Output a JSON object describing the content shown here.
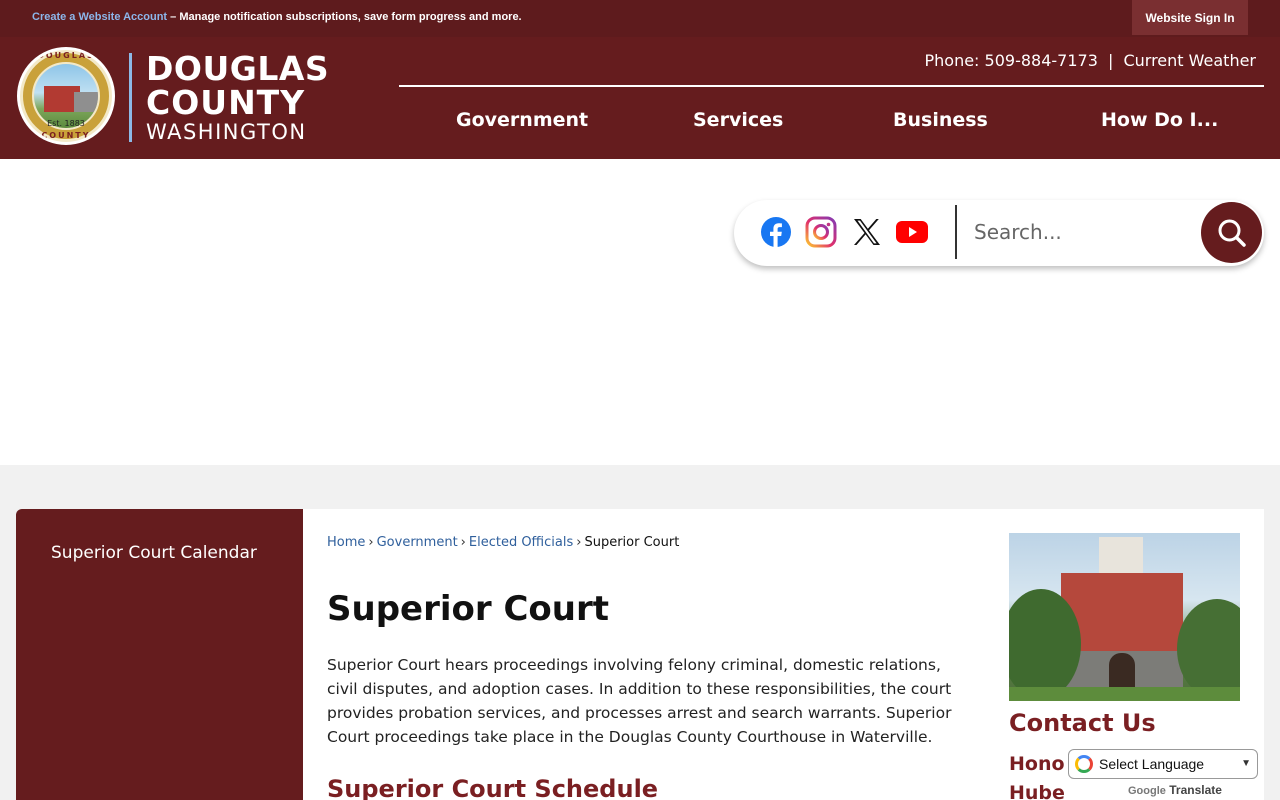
{
  "topbar": {
    "account_link": "Create a Website Account",
    "account_desc": " – Manage notification subscriptions, save form progress and more.",
    "signin_label": "Website Sign In"
  },
  "header": {
    "logo": {
      "seal_top": "DOUGLAS",
      "seal_est": "Est. 1883",
      "seal_bottom": "COUNTY",
      "line1": "DOUGLAS",
      "line2": "COUNTY",
      "line3": "WASHINGTON"
    },
    "phone": "Phone: 509-884-7173",
    "separator": "|",
    "weather": "Current Weather",
    "nav": [
      {
        "label": "Government"
      },
      {
        "label": "Services"
      },
      {
        "label": "Business"
      },
      {
        "label": "How Do I..."
      }
    ]
  },
  "social": {
    "icons": [
      "facebook-icon",
      "instagram-icon",
      "x-icon",
      "youtube-icon"
    ]
  },
  "search": {
    "placeholder": "Search..."
  },
  "sidebar": {
    "items": [
      {
        "label": "Superior Court Calendar"
      }
    ]
  },
  "breadcrumb": {
    "items": [
      {
        "label": "Home"
      },
      {
        "label": "Government"
      },
      {
        "label": "Elected Officials"
      },
      {
        "label": "Superior Court"
      }
    ],
    "separator": "›"
  },
  "main": {
    "title": "Superior Court",
    "body": "Superior Court hears proceedings involving felony criminal, domestic relations, civil disputes, and adoption cases. In addition to these responsibilities, the court provides probation services, and processes arrest and search warrants. Superior Court proceedings take place in the Douglas County Courthouse in Waterville.",
    "section_heading": "Superior Court Schedule"
  },
  "aside": {
    "contact_heading": "Contact Us",
    "contact_name_line1": "Honor",
    "contact_name_line2": "Huber"
  },
  "translate": {
    "select_label": "Select Language",
    "powered_google": "Google",
    "powered_translate": "Translate"
  },
  "colors": {
    "brand_maroon": "#651c1e",
    "topbar_maroon": "#5e1b1d",
    "link_blue": "#2f5f9c",
    "heading_red": "#7a1f22"
  }
}
